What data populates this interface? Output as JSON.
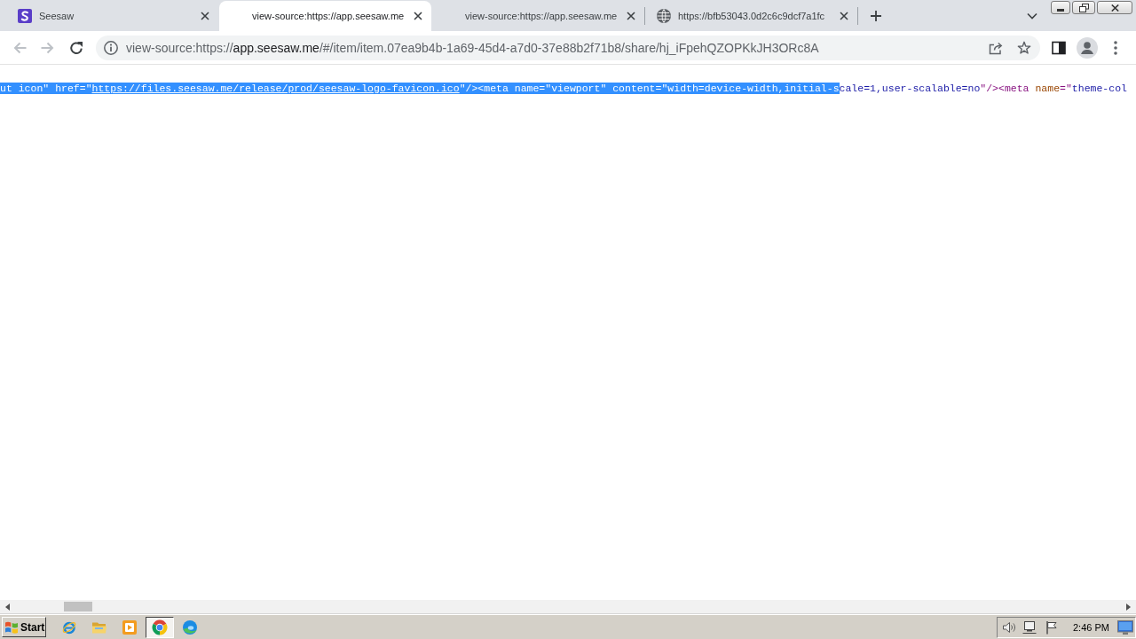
{
  "tabs": [
    {
      "title": "Seesaw",
      "kind": "site",
      "selected": false
    },
    {
      "title": "view-source:https://app.seesaw.me",
      "kind": "source",
      "selected": true
    },
    {
      "title": "view-source:https://app.seesaw.me",
      "kind": "source",
      "selected": false
    },
    {
      "title": "https://bfb53043.0d2c6c9dcf7a1fc",
      "kind": "web",
      "selected": false
    }
  ],
  "toolbar": {
    "back": {
      "disabled": true
    },
    "forward": {
      "disabled": true
    }
  },
  "address": {
    "scheme": "view-source:https://",
    "host": "app.seesaw.me",
    "path": "/#/item/item.07ea9b4b-1a69-45d4-a7d0-37e88b2f71b8/share/hj_iFpehQZOPKkJH3ORc8A"
  },
  "source_line": {
    "tokens": [
      {
        "kind": "value",
        "text": "ut icon",
        "selected": true
      },
      {
        "kind": "tag",
        "text": "\" ",
        "selected": true
      },
      {
        "kind": "attr",
        "text": "href",
        "selected": true
      },
      {
        "kind": "tag",
        "text": "=\"",
        "selected": true
      },
      {
        "kind": "link",
        "text": "https://files.seesaw.me/release/prod/seesaw-logo-favicon.ico",
        "selected": true
      },
      {
        "kind": "tag",
        "text": "\"/><meta ",
        "selected": true
      },
      {
        "kind": "attr",
        "text": "name",
        "selected": true
      },
      {
        "kind": "tag",
        "text": "=\"",
        "selected": true
      },
      {
        "kind": "value",
        "text": "viewport",
        "selected": true
      },
      {
        "kind": "tag",
        "text": "\" ",
        "selected": true
      },
      {
        "kind": "attr",
        "text": "content",
        "selected": true
      },
      {
        "kind": "tag",
        "text": "=\"",
        "selected": true
      },
      {
        "kind": "value",
        "text": "width=device-width,initial-s",
        "selected": true
      },
      {
        "kind": "value",
        "text": "cale=1,user-scalable=no",
        "selected": false
      },
      {
        "kind": "tag",
        "text": "\"/><meta ",
        "selected": false
      },
      {
        "kind": "attr",
        "text": "name",
        "selected": false
      },
      {
        "kind": "tag",
        "text": "=\"",
        "selected": false
      },
      {
        "kind": "value",
        "text": "theme-col",
        "selected": false
      }
    ]
  },
  "taskbar": {
    "start_label": "Start",
    "apps": [
      {
        "kind": "ie",
        "active": false
      },
      {
        "kind": "folder",
        "active": false
      },
      {
        "kind": "media",
        "active": false
      },
      {
        "kind": "chrome",
        "active": true
      },
      {
        "kind": "edge",
        "active": false
      }
    ],
    "clock": "2:46 PM"
  }
}
